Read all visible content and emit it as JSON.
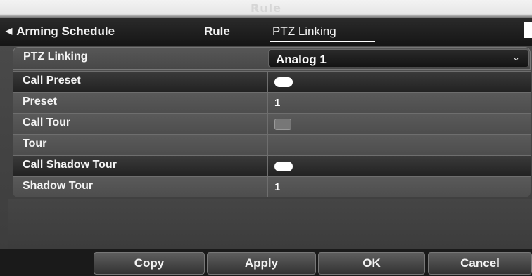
{
  "window": {
    "title": "Rule"
  },
  "tabs": {
    "arming_schedule": "Arming Schedule",
    "rule": "Rule",
    "ptz_linking": "PTZ Linking"
  },
  "form": {
    "ptz_linking": {
      "label": "PTZ Linking",
      "value": "Analog 1"
    },
    "call_preset": {
      "label": "Call Preset",
      "enabled": true
    },
    "preset": {
      "label": "Preset",
      "value": "1"
    },
    "call_tour": {
      "label": "Call Tour",
      "enabled": false
    },
    "tour": {
      "label": "Tour",
      "value": ""
    },
    "call_shadow_tour": {
      "label": "Call Shadow Tour",
      "enabled": true
    },
    "shadow_tour": {
      "label": "Shadow Tour",
      "value": "1"
    }
  },
  "buttons": {
    "copy": "Copy",
    "apply": "Apply",
    "ok": "OK",
    "cancel": "Cancel"
  },
  "icons": {
    "back": "back-arrow-icon",
    "dropdown": "chevron-down-icon"
  }
}
